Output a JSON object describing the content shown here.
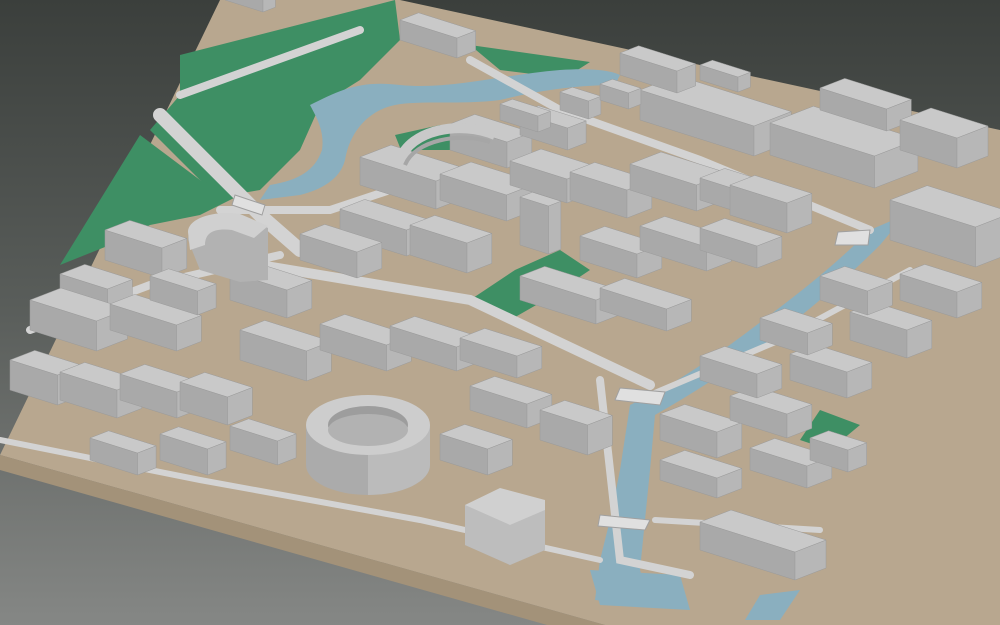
{
  "scene": {
    "kind": "isometric 3D city block model",
    "colors": {
      "background_top": "#3b3f3c",
      "background_bottom": "#848684",
      "ground": "#b6a58d",
      "ground_side": "#a8977f",
      "park": "#3e8f64",
      "water": "#8aafbf",
      "road": "#cfcfcf",
      "building_top": "#c9c9c9",
      "building_left": "#a9a9a9",
      "building_right": "#b7b7b7"
    },
    "features": [
      "park",
      "canal",
      "river",
      "circular-building",
      "hexagonal-building",
      "streets",
      "bridges"
    ]
  }
}
